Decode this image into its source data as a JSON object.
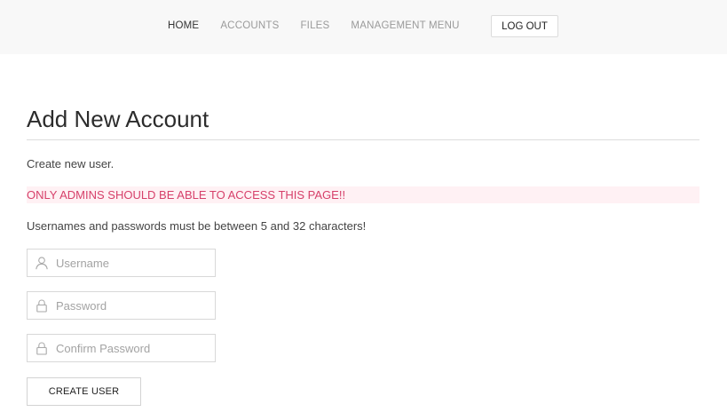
{
  "nav": {
    "items": [
      {
        "label": "HOME",
        "active": true
      },
      {
        "label": "ACCOUNTS",
        "active": false
      },
      {
        "label": "FILES",
        "active": false
      },
      {
        "label": "MANAGEMENT MENU",
        "active": false
      }
    ],
    "logout_label": "LOG OUT"
  },
  "page": {
    "title": "Add New Account",
    "intro": "Create new user.",
    "warning": "ONLY ADMINS SHOULD BE ABLE TO ACCESS THIS PAGE!!",
    "rules": "Usernames and passwords must be between 5 and 32 characters!"
  },
  "form": {
    "username": {
      "placeholder": "Username",
      "value": "",
      "icon": "user-icon"
    },
    "password": {
      "placeholder": "Password",
      "value": "",
      "icon": "lock-icon"
    },
    "confirm": {
      "placeholder": "Confirm Password",
      "value": "",
      "icon": "lock-icon"
    },
    "submit_label": "CREATE USER"
  },
  "colors": {
    "nav_bg": "#f8f8f8",
    "warning_text": "#d6406a",
    "warning_bg": "#fff1f4",
    "icon": "#a8a8a8"
  }
}
